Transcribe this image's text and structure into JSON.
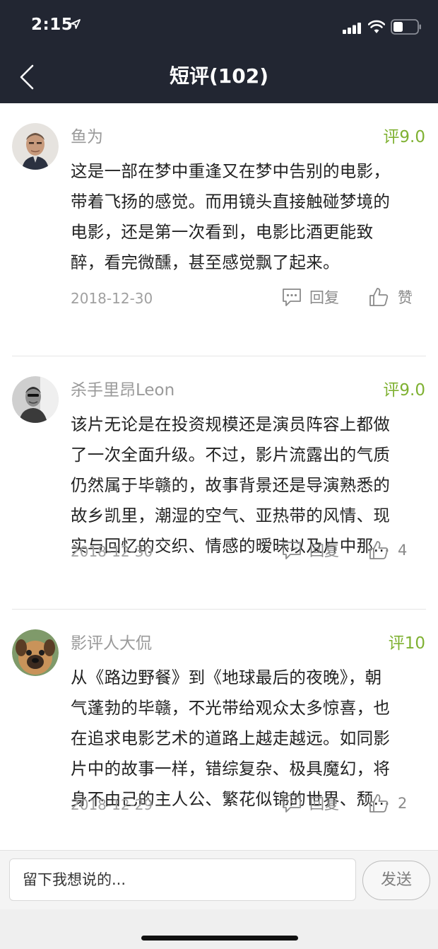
{
  "status_bar": {
    "time": "2:15"
  },
  "header": {
    "title": "短评(102)"
  },
  "comments": [
    {
      "username": "鱼为",
      "score": "评9.0",
      "lines": [
        "这是一部在梦中重逢又在梦中告别的电影，",
        "带着飞扬的感觉。而用镜头直接触碰梦境的",
        "电影，还是第一次看到，电影比酒更能致",
        "醉，看完微醺，甚至感觉飘了起来。"
      ],
      "date": "2018-12-30",
      "reply_label": "回复",
      "like_label": "赞"
    },
    {
      "username": "杀手里昂Leon",
      "score": "评9.0",
      "lines": [
        "该片无论是在投资规模还是演员阵容上都做",
        "了一次全面升级。不过，影片流露出的气质",
        "仍然属于毕赣的，故事背景还是导演熟悉的",
        "故乡凯里，潮湿的空气、亚热带的风情、现",
        "实与回忆的交织、情感的暧昧以及片中那…"
      ],
      "date": "2018-12-30",
      "reply_label": "回复",
      "like_label": "4"
    },
    {
      "username": "影评人大侃",
      "score": "评10",
      "lines": [
        "从《路边野餐》到《地球最后的夜晚》，朝",
        "气蓬勃的毕赣，不光带给观众太多惊喜，也",
        "在追求电影艺术的道路上越走越远。如同影",
        "片中的故事一样，错综复杂、极具魔幻，将",
        "身不由己的主人公、繁花似锦的世界、颓…"
      ],
      "date": "2018-12-29",
      "reply_label": "回复",
      "like_label": "2"
    }
  ],
  "input": {
    "placeholder": "留下我想说的..."
  },
  "send_label": "发送",
  "colors": {
    "header_bg": "#222632",
    "score_green": "#7fb132"
  },
  "icons": [
    "location-arrow-icon",
    "signal-icon",
    "wifi-icon",
    "battery-icon",
    "back-chevron-icon",
    "reply-bubble-icon",
    "thumbs-up-icon"
  ]
}
